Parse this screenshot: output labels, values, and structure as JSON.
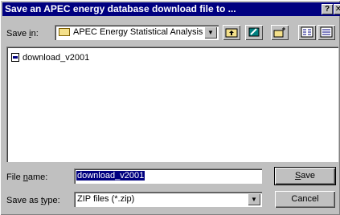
{
  "window": {
    "title": "Save an APEC energy database download file to ...",
    "help_glyph": "?",
    "close_glyph": "✕"
  },
  "save_in": {
    "label_pre": "Save ",
    "label_hot": "i",
    "label_post": "n:",
    "value": "APEC Energy Statistical Analysis T"
  },
  "toolbar": {
    "icons": [
      "up-one-level-icon",
      "desktop-icon",
      "new-folder-icon",
      "list-view-icon",
      "details-view-icon"
    ]
  },
  "file_list": {
    "items": [
      {
        "name": "download_v2001",
        "icon": "file-icon"
      }
    ]
  },
  "file_name": {
    "label_pre": "File ",
    "label_hot": "n",
    "label_post": "ame:",
    "value": "download_v2001"
  },
  "save_as_type": {
    "label_pre": "Save as ",
    "label_hot": "t",
    "label_post": "ype:",
    "value": "ZIP files (*.zip)"
  },
  "buttons": {
    "save_hot": "S",
    "save_rest": "ave",
    "cancel": "Cancel"
  },
  "colors": {
    "titlebar": "#000080",
    "face": "#c0c0c0",
    "selection": "#000080"
  }
}
